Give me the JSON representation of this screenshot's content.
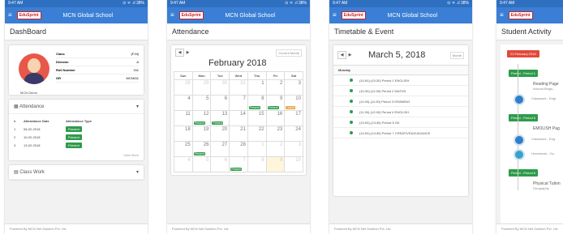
{
  "common": {
    "time": "9:47 AM",
    "status_icons": "⊙ ᯤ .ıl 38%",
    "logo": "EduSprint",
    "school": "MCN Global School",
    "footer": "Powered By MCN Net Solution Pvt. Ltd."
  },
  "dashboard": {
    "title": "DashBoard",
    "profile_rows": [
      {
        "label": "Class",
        "value": "(F:M)"
      },
      {
        "label": "Division",
        "value": "A"
      },
      {
        "label": "Roll Number",
        "value": "011"
      },
      {
        "label": "GR",
        "value": "MCN011"
      }
    ],
    "student_name": "MCN Demo",
    "attendance_title": "Attendance",
    "headers": [
      "#",
      "Attendance Date",
      "Attendance Type"
    ],
    "rows": [
      {
        "n": "1",
        "date": "08-02-2018",
        "type": "Present"
      },
      {
        "n": "2",
        "date": "10-02-2018",
        "type": "Present"
      },
      {
        "n": "3",
        "date": "13-02-2018",
        "type": "Present"
      }
    ],
    "view_more": "View More",
    "classwork_title": "Class Work"
  },
  "attendance": {
    "title": "Attendance",
    "month": "February 2018",
    "current_month": "Current Month",
    "days": [
      "Sun",
      "Mon",
      "Tue",
      "Wed",
      "Thu",
      "Fri",
      "Sat"
    ],
    "cells": [
      {
        "d": "28",
        "o": true
      },
      {
        "d": "29",
        "o": true
      },
      {
        "d": "30",
        "o": true
      },
      {
        "d": "31",
        "o": true
      },
      {
        "d": "1"
      },
      {
        "d": "2"
      },
      {
        "d": "3"
      },
      {
        "d": "4"
      },
      {
        "d": "5"
      },
      {
        "d": "6"
      },
      {
        "d": "7"
      },
      {
        "d": "8",
        "e": "Present",
        "c": "#2e9b4a"
      },
      {
        "d": "9",
        "e": "Present",
        "c": "#2e9b4a"
      },
      {
        "d": "10",
        "e": "Leave",
        "c": "#e8a33a"
      },
      {
        "d": "11"
      },
      {
        "d": "12",
        "e": "Present",
        "c": "#2e9b4a"
      },
      {
        "d": "13",
        "e": "Present",
        "c": "#2e9b4a"
      },
      {
        "d": "14"
      },
      {
        "d": "15"
      },
      {
        "d": "16"
      },
      {
        "d": "17"
      },
      {
        "d": "18"
      },
      {
        "d": "19"
      },
      {
        "d": "20"
      },
      {
        "d": "21"
      },
      {
        "d": "22"
      },
      {
        "d": "23"
      },
      {
        "d": "24"
      },
      {
        "d": "25"
      },
      {
        "d": "26",
        "e": "Present",
        "c": "#2e9b4a"
      },
      {
        "d": "27"
      },
      {
        "d": "28"
      },
      {
        "d": "1",
        "o": true
      },
      {
        "d": "2",
        "o": true
      },
      {
        "d": "3",
        "o": true
      },
      {
        "d": "4",
        "o": true
      },
      {
        "d": "5",
        "o": true
      },
      {
        "d": "6",
        "o": true
      },
      {
        "d": "7",
        "o": true,
        "e": "Present",
        "c": "#2e9b4a"
      },
      {
        "d": "8",
        "o": true
      },
      {
        "d": "9",
        "o": true,
        "t": true
      },
      {
        "d": "10",
        "o": true
      }
    ]
  },
  "timetable": {
    "title": "Timetable & Event",
    "date": "March 5, 2018",
    "view": "Month",
    "day_label": "Monday",
    "rows": [
      "(10:00)-(10:30) Period 1 ENGLISH",
      "(10:30)-(11:00) Period 2 MATHS",
      "(11:00)-(11:30) Period 3 DRAWING",
      "(11:30)-(12:00) Period 4 ENGLISH",
      "(13:00)-(13:45) Period 5 GK",
      "(14:00)-(14:45) Period 7 CREATIVE&GUIDANCE"
    ]
  },
  "activity": {
    "title": "Student Activity",
    "date": "21 February 2018",
    "items": [
      {
        "period": "Period - Period 1",
        "text": "Reading Page",
        "sub": "Around Bingo...",
        "class": "Classwork - Engl"
      },
      {
        "period": "Period - Period 6",
        "text": "EMOLISH Pag",
        "sub": "",
        "class": "Classwork - Eng"
      },
      {
        "period": "",
        "text": "",
        "sub": "",
        "class": "Homework - Gu"
      },
      {
        "period": "Period - Period 6",
        "text": "Physical Tution",
        "sub": "Geography",
        "class": ""
      }
    ]
  }
}
